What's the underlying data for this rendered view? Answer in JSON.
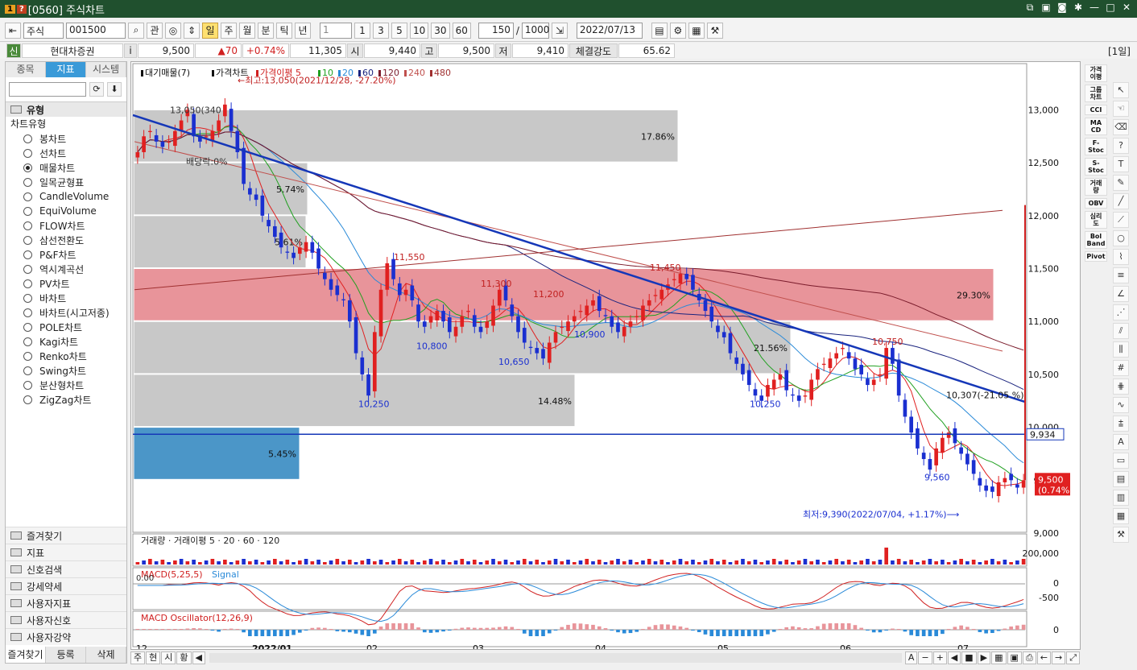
{
  "window": {
    "badge": "1",
    "badge2": "?",
    "title": "[0560] 주식차트"
  },
  "toolbar": {
    "market": "주식",
    "code": "001500",
    "btn_gwan": "관",
    "periods": [
      "일",
      "주",
      "월",
      "분",
      "틱",
      "년"
    ],
    "active_period": "일",
    "period_num": "1",
    "quick": [
      "1",
      "3",
      "5",
      "10",
      "30",
      "60"
    ],
    "count": "150",
    "total": "1000",
    "date": "2022/07/13"
  },
  "infobar": {
    "sin": "신",
    "name": "현대차증권",
    "i": "i",
    "price": "9,500",
    "change": "▲70",
    "pct": "+0.74%",
    "volume": "11,305",
    "open_label": "시",
    "open": "9,440",
    "high_label": "고",
    "high": "9,500",
    "low_label": "저",
    "low": "9,410",
    "strength_label": "체결강도",
    "strength": "65.62",
    "period_tag": "[1일]"
  },
  "left": {
    "tabs": [
      "종목",
      "지표",
      "시스템"
    ],
    "active_tab": "지표",
    "section": "유형",
    "subsection": "차트유형",
    "items": [
      "봉차트",
      "선차트",
      "매물차트",
      "일목균형표",
      "CandleVolume",
      "EquiVolume",
      "FLOW차트",
      "삼선전환도",
      "P&F차트",
      "역시계곡선",
      "PV차트",
      "바차트",
      "바차트(시고저종)",
      "POLE차트",
      "Kagi차트",
      "Renko차트",
      "Swing차트",
      "분산형차트",
      "ZigZag차트"
    ],
    "selected": "매물차트",
    "folders": [
      "즐겨찾기",
      "지표",
      "신호검색",
      "강세약세",
      "사용자지표",
      "사용자신호",
      "사용자강약"
    ],
    "bottom": [
      "즐겨찾기",
      "등록",
      "삭제"
    ]
  },
  "chart": {
    "legend_main": [
      "대기매물(7)",
      "가격차트",
      "가격이평 5",
      "10",
      "20",
      "60",
      "120",
      "240",
      "480"
    ],
    "legend_volume": [
      "거래량",
      "거래이평 5",
      "20",
      "60",
      "120"
    ],
    "legend_macd": [
      "MACD(5,25,5)",
      "Signal"
    ],
    "legend_osc": [
      "MACD Oscillator(12,26,9)"
    ],
    "annot": {
      "high": "←최고:13,050(2021/12/28, -27.20%)",
      "low": "최저:9,390(2022/07/04, +1.17%)⟶",
      "trend": "10,307(-21.05 %)",
      "div": "배당락:0%",
      "h1": "13,050(340",
      "p1": "11,550",
      "p2": "11,300",
      "p3": "11,200",
      "p4": "11,450",
      "p5": "10,750",
      "l1": "10,800",
      "l2": "10,650",
      "l3": "10,900",
      "l4": "10,250",
      "l5": "10,250",
      "l6": "9,560"
    },
    "current": {
      "price": "9,500",
      "pct": "(0.74%)",
      "line": "9,934"
    },
    "yticks": [
      "13,000",
      "12,500",
      "12,000",
      "11,500",
      "11,000",
      "10,500",
      "10,000",
      "9,500",
      "9,000"
    ],
    "vol_tick": "200,000",
    "macd_ticks": [
      "0",
      "-500"
    ],
    "macd_zero": "0.00",
    "osc_tick": "0",
    "xticks": [
      "12",
      "2022/01",
      "02",
      "03",
      "04",
      "05",
      "06",
      "07"
    ],
    "colors": {
      "up": "#e02020",
      "down": "#1a2fd0",
      "trend": "#1537b8"
    }
  },
  "chart_data": {
    "type": "candlestick",
    "volume_profile": [
      {
        "range": [
          12500,
          13000
        ],
        "pct": "17.86%"
      },
      {
        "range": [
          12000,
          12500
        ],
        "pct": "5.74%"
      },
      {
        "range": [
          11500,
          12000
        ],
        "pct": "5.61%"
      },
      {
        "range": [
          11000,
          11500
        ],
        "pct": "29.30%"
      },
      {
        "range": [
          10500,
          11000
        ],
        "pct": "21.56%"
      },
      {
        "range": [
          10000,
          10500
        ],
        "pct": "14.48%"
      },
      {
        "range": [
          9500,
          10000
        ],
        "pct": "5.45%"
      }
    ],
    "closes": [
      12600,
      12750,
      12800,
      12700,
      12650,
      12700,
      12800,
      12900,
      13000,
      12750,
      12700,
      12750,
      12800,
      12900,
      13050,
      12800,
      12600,
      12300,
      12200,
      12150,
      12000,
      11900,
      11800,
      11700,
      11650,
      11600,
      11700,
      11750,
      11650,
      11500,
      11400,
      11300,
      11250,
      11200,
      11000,
      10700,
      10500,
      10300,
      10900,
      11300,
      11550,
      11400,
      11250,
      11300,
      11200,
      11000,
      10950,
      11050,
      11100,
      11000,
      10900,
      10950,
      11050,
      11100,
      10950,
      10900,
      11000,
      11150,
      11300,
      11200,
      11050,
      10900,
      10800,
      10750,
      10700,
      10650,
      10800,
      10900,
      10950,
      11000,
      11050,
      11100,
      11150,
      11200,
      11100,
      11050,
      10950,
      10900,
      10950,
      11000,
      11050,
      11150,
      11200,
      11250,
      11300,
      11350,
      11400,
      11450,
      11400,
      11300,
      11200,
      11100,
      11000,
      10900,
      10850,
      10700,
      10600,
      10500,
      10400,
      10300,
      10250,
      10400,
      10450,
      10500,
      10350,
      10300,
      10250,
      10300,
      10450,
      10550,
      10600,
      10650,
      10700,
      10750,
      10650,
      10550,
      10500,
      10400,
      10450,
      10500,
      10750,
      10600,
      10300,
      10100,
      9950,
      9800,
      9700,
      9600,
      9800,
      9900,
      9950,
      9850,
      9750,
      9650,
      9560,
      9450,
      9400,
      9390,
      9480,
      9520,
      9500,
      9430,
      9500
    ],
    "ma5_last": 9600,
    "trendline": [
      [
        0,
        12800
      ],
      [
        150,
        10307
      ]
    ],
    "high": 13050,
    "low": 9390,
    "ylim": [
      9000,
      13300
    ]
  }
}
